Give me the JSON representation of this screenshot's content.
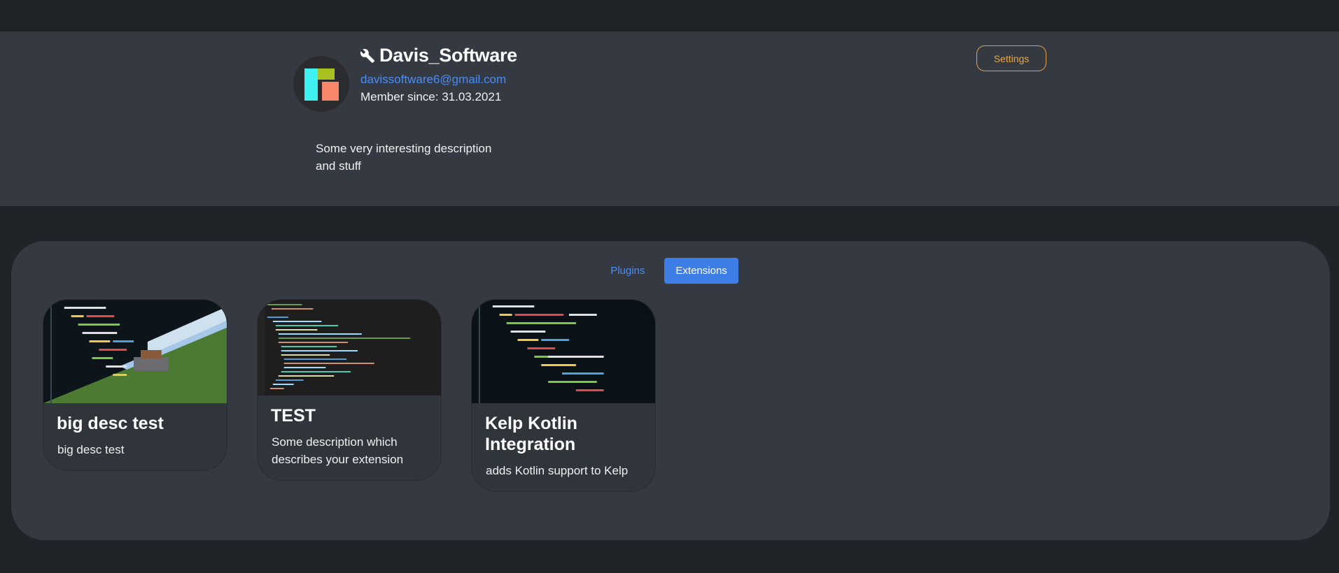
{
  "profile": {
    "username": "Davis_Software",
    "email": "davissoftware6@gmail.com",
    "member_since_label": "Member since: 31.03.2021",
    "description": "Some very interesting description and stuff",
    "settings_label": "Settings"
  },
  "tabs": [
    {
      "label": "Plugins",
      "active": false
    },
    {
      "label": "Extensions",
      "active": true
    }
  ],
  "cards": [
    {
      "title": "big desc test",
      "description": "big desc test"
    },
    {
      "title": "TEST",
      "description": "Some description which describes your extension"
    },
    {
      "title": "Kelp Kotlin Integration",
      "description": "adds Kotlin support to Kelp"
    }
  ],
  "colors": {
    "accent": "#3d7fe6",
    "link": "#4a8df5",
    "settings": "#e8a84c",
    "panel": "#353a42",
    "background": "#202327"
  }
}
